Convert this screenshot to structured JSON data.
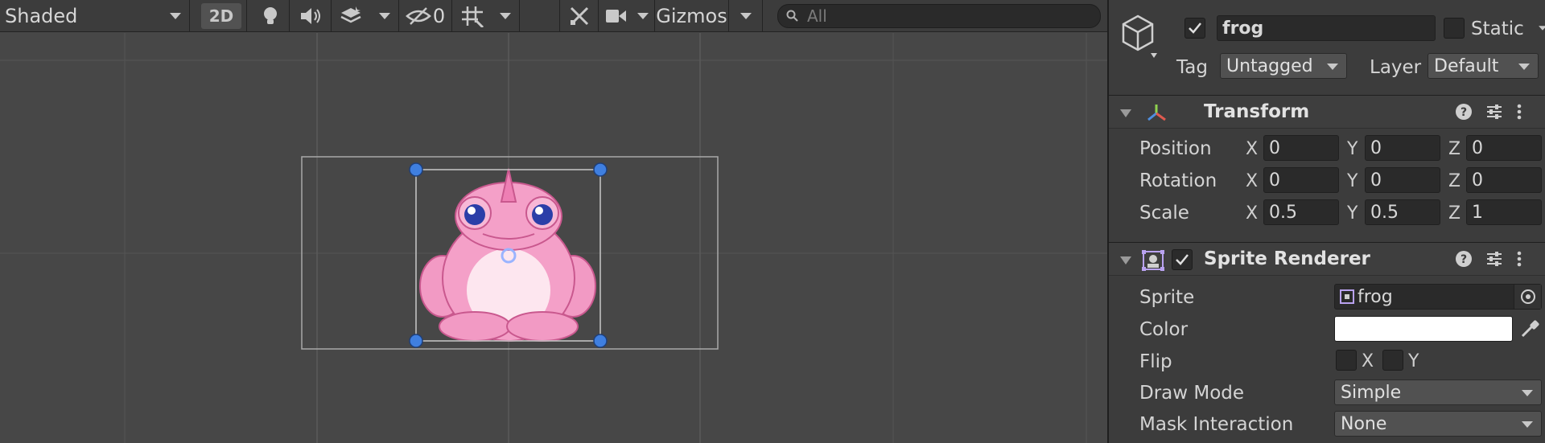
{
  "scene_toolbar": {
    "shading_mode": "Shaded",
    "mode_2d_label": "2D",
    "hidden_count": "0",
    "gizmos_label": "Gizmos",
    "search_placeholder": "All"
  },
  "inspector": {
    "object_name": "frog",
    "object_active": true,
    "static_label": "Static",
    "tag_label": "Tag",
    "tag_value": "Untagged",
    "layer_label": "Layer",
    "layer_value": "Default",
    "transform": {
      "title": "Transform",
      "rows": [
        {
          "label": "Position",
          "x": "0",
          "y": "0",
          "z": "0"
        },
        {
          "label": "Rotation",
          "x": "0",
          "y": "0",
          "z": "0"
        },
        {
          "label": "Scale",
          "x": "0.5",
          "y": "0.5",
          "z": "1"
        }
      ],
      "axis_x": "X",
      "axis_y": "Y",
      "axis_z": "Z"
    },
    "sprite_renderer": {
      "title": "Sprite Renderer",
      "enabled": true,
      "sprite_label": "Sprite",
      "sprite_value": "frog",
      "color_label": "Color",
      "color_value": "#ffffff",
      "flip_label": "Flip",
      "flip_x": "X",
      "flip_y": "Y",
      "draw_mode_label": "Draw Mode",
      "draw_mode_value": "Simple",
      "mask_label": "Mask Interaction",
      "mask_value": "None"
    }
  },
  "colors": {
    "scene_bg": "#474747",
    "panel_bg": "#3c3c3c",
    "handle_blue": "#3f7fe0",
    "frog_pink": "#f29ac4"
  }
}
